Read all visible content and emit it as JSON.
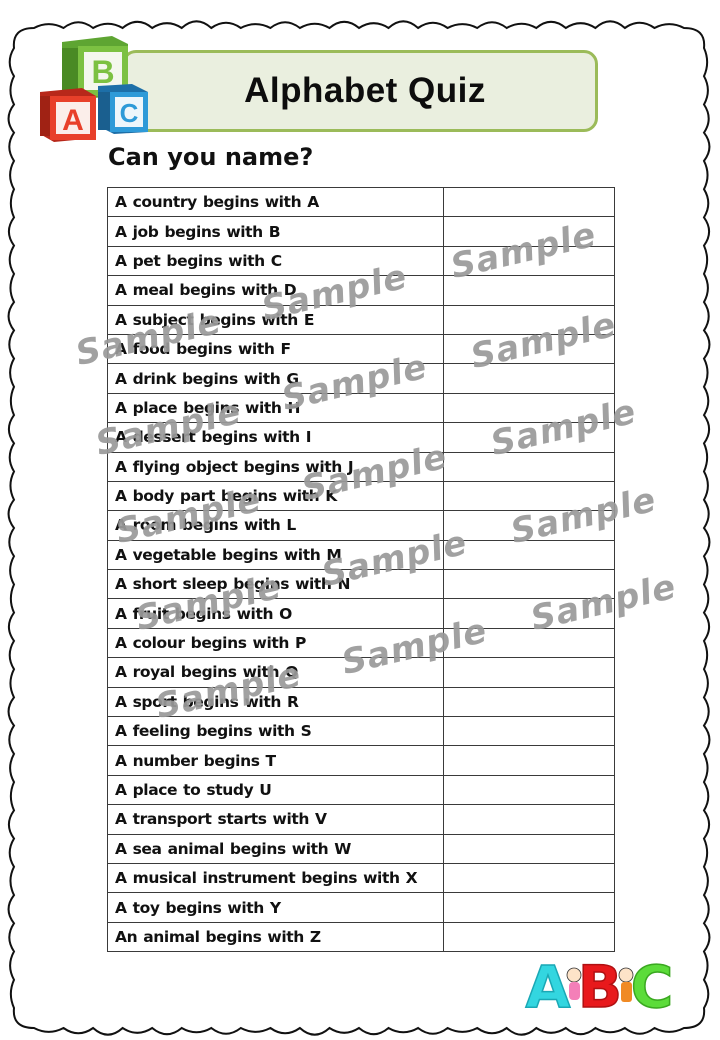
{
  "header": {
    "title": "Alphabet Quiz",
    "blocks_letters": [
      "A",
      "B",
      "C"
    ],
    "block_colors": {
      "A": "#e8402a",
      "B": "#7cc142",
      "C": "#2e9ad8"
    }
  },
  "subtitle": "Can you name?",
  "table": {
    "rows": [
      {
        "prompt": "A country begins with  A",
        "answer": ""
      },
      {
        "prompt": "A job begins with  B",
        "answer": ""
      },
      {
        "prompt": "A pet begins with C",
        "answer": ""
      },
      {
        "prompt": "A meal  begins with  D",
        "answer": ""
      },
      {
        "prompt": "A subject begins with  E",
        "answer": ""
      },
      {
        "prompt": "A food begins with  F",
        "answer": ""
      },
      {
        "prompt": "A drink begins with G",
        "answer": ""
      },
      {
        "prompt": "A place begins with H",
        "answer": ""
      },
      {
        "prompt": "A dessert begins with I",
        "answer": ""
      },
      {
        "prompt": "A flying object  begins with J",
        "answer": ""
      },
      {
        "prompt": "A body part begins with  K",
        "answer": ""
      },
      {
        "prompt": "A room begins with  L",
        "answer": ""
      },
      {
        "prompt": "A vegetable begins with  M",
        "answer": ""
      },
      {
        "prompt": "A short sleep begins with N",
        "answer": ""
      },
      {
        "prompt": "A fruit begins with O",
        "answer": ""
      },
      {
        "prompt": "A colour begins with P",
        "answer": ""
      },
      {
        "prompt": "A royal begins with Q",
        "answer": ""
      },
      {
        "prompt": "A sport begins with R",
        "answer": ""
      },
      {
        "prompt": "A feeling   begins with S",
        "answer": ""
      },
      {
        "prompt": "A number begins  T",
        "answer": ""
      },
      {
        "prompt": "A place to study  U",
        "answer": ""
      },
      {
        "prompt": "A transport  starts with V",
        "answer": ""
      },
      {
        "prompt": " A sea animal begins with  W",
        "answer": ""
      },
      {
        "prompt": "A musical instrument  begins  with X",
        "answer": ""
      },
      {
        "prompt": "A toy begins with Y",
        "answer": ""
      },
      {
        "prompt": "An animal begins with Z",
        "answer": ""
      }
    ]
  },
  "watermark": {
    "text": "Sample",
    "color": "#9a9a9a",
    "count": 15
  },
  "footer_logo": {
    "letters": [
      "A",
      "B",
      "C"
    ],
    "colors": {
      "A": "#33d6e0",
      "B": "#e8191c",
      "C": "#5cdc3a"
    }
  }
}
